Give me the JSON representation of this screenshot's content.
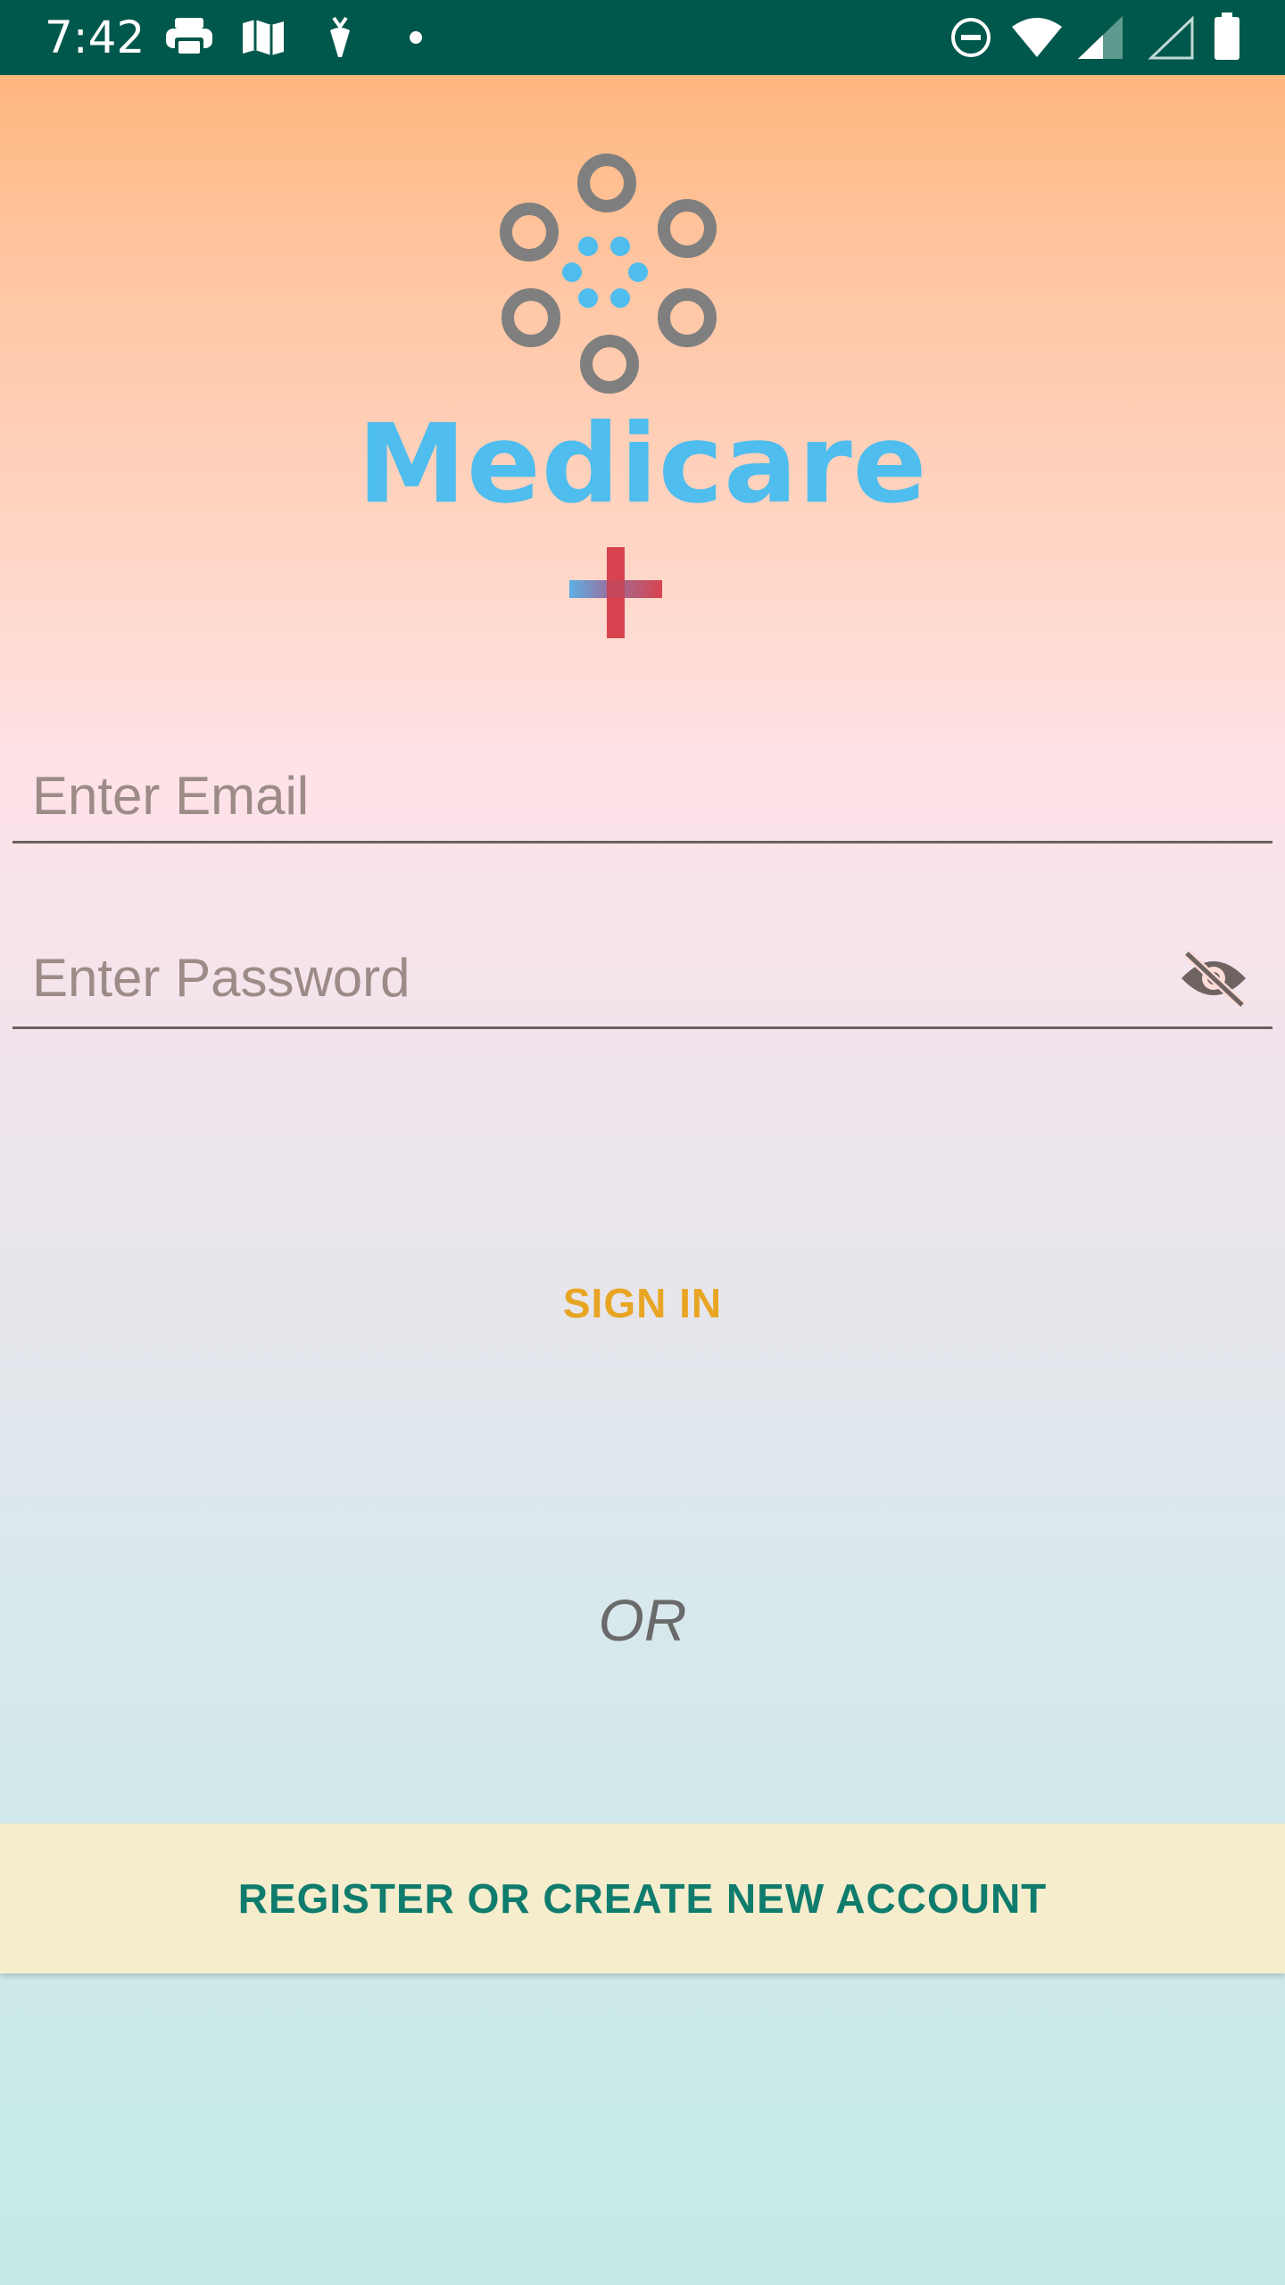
{
  "status_bar": {
    "time": "7:42",
    "background_color": "#00574B",
    "notification_icons": [
      "printer-icon",
      "map-icon",
      "carrot-icon",
      "dot-icon"
    ],
    "system_icons": [
      "do-not-disturb-icon",
      "wifi-icon",
      "cell-signal-icon",
      "cell-signal-empty-icon",
      "battery-icon"
    ]
  },
  "logo": {
    "app_name": "Medicare",
    "brand_color": "#4FBDEE",
    "cross_colors": [
      "#5EAFE6",
      "#D9434F"
    ]
  },
  "form": {
    "email_placeholder": "Enter Email",
    "email_value": "",
    "password_placeholder": "Enter Password",
    "password_value": "",
    "password_visibility_icon": "eye-off-icon"
  },
  "actions": {
    "sign_in_label": "SIGN IN",
    "sign_in_color": "#E8A524",
    "or_label": "OR",
    "register_label": "REGISTER OR CREATE NEW ACCOUNT",
    "register_color": "#0F7C6D",
    "register_background": "#F6EDCD"
  }
}
